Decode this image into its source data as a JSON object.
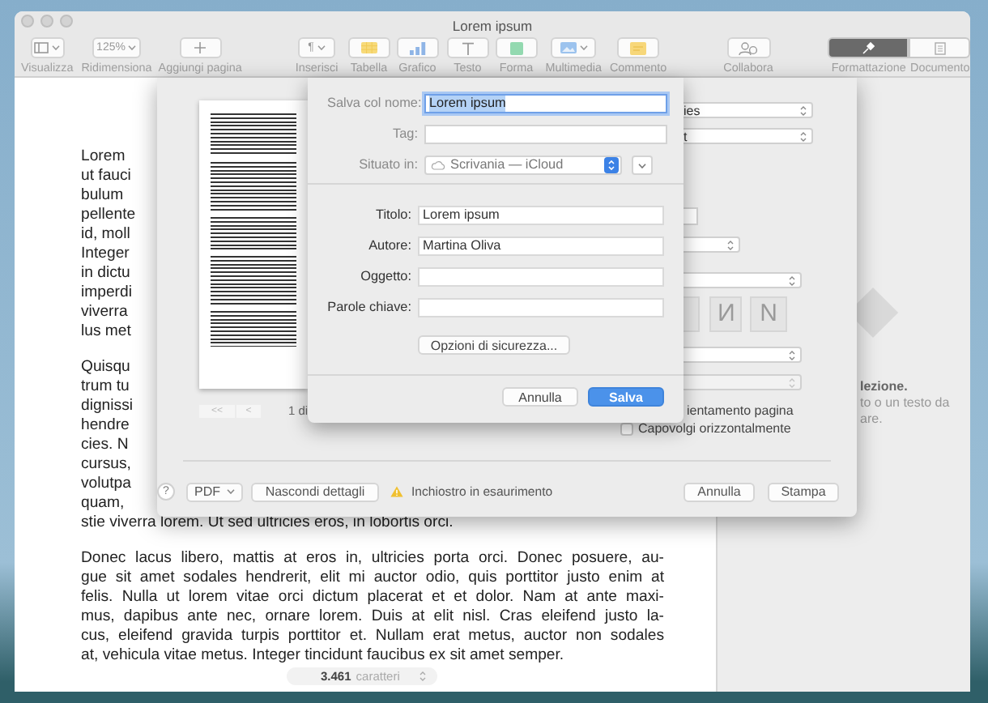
{
  "window": {
    "title": "Lorem ipsum"
  },
  "toolbar": [
    {
      "kind": "view",
      "label": "Visualizza"
    },
    {
      "kind": "zoom",
      "label": "Ridimensiona",
      "value": "125%"
    },
    {
      "kind": "add",
      "label": "Aggiungi pagina"
    },
    {
      "kind": "insert",
      "label": "Inserisci",
      "value": "¶"
    },
    {
      "kind": "table",
      "label": "Tabella"
    },
    {
      "kind": "chart",
      "label": "Grafico"
    },
    {
      "kind": "text",
      "label": "Testo"
    },
    {
      "kind": "shape",
      "label": "Forma"
    },
    {
      "kind": "media",
      "label": "Multimedia"
    },
    {
      "kind": "comment",
      "label": "Commento"
    },
    {
      "kind": "collab",
      "label": "Collabora"
    }
  ],
  "inspector_tabs": [
    {
      "kind": "format",
      "label": "Formattazione",
      "selected": true
    },
    {
      "kind": "document",
      "label": "Documento",
      "selected": false
    }
  ],
  "document": {
    "paragraphs": [
      {
        "cut_off": true,
        "lines": [
          "Lorem",
          "ut fauci",
          "bulum",
          "pellente",
          "id, moll",
          "Integer",
          "in dictu",
          "imperdi",
          "viverra",
          "lus met"
        ]
      },
      {
        "cut_off": true,
        "lines": [
          "Quisqu",
          "trum tu",
          "dignissi",
          "hendre",
          "cies. N",
          "cursus,",
          "volutpa",
          "quam,",
          "stie viverra lorem. Ut sed ultricies eros, in lobortis orci."
        ]
      },
      {
        "cut_off": false,
        "lines": [
          "Donec lacus libero, mattis at eros in, ultricies porta orci. Donec posuere, au-",
          "gue sit amet sodales hendrerit, elit mi auctor odio, quis porttitor justo enim at",
          "felis. Nulla ut lorem vitae orci dictum placerat et et dolor. Nam at ante maxi-",
          "mus, dapibus ante nec, ornare lorem. Duis at elit nisl. Cras eleifend justo la-",
          "cus, eleifend gravida turpis porttitor et. Nullam erat metus, auctor non sodales",
          "at, vehicula vitae metus. Integer tincidunt faucibus ex sit amet semper."
        ]
      }
    ]
  },
  "word_count": {
    "count": "3.461",
    "label": "caratteri"
  },
  "inspector": {
    "lines": [
      "lezione.",
      "to o un testo da",
      "are."
    ]
  },
  "print_sheet": {
    "page_nav": [
      "<<",
      "<"
    ],
    "page_indicator": "1 di",
    "settings": [
      {
        "kind": "popup",
        "value": "ies",
        "disabled": false
      },
      {
        "kind": "popup",
        "value": "t",
        "disabled": false
      },
      {
        "kind": "field"
      },
      {
        "kind": "popup",
        "disabled": false
      },
      {
        "kind": "popup",
        "disabled": false
      },
      {
        "kind": "style_buttons",
        "buttons": [
          {
            "kind": "blank"
          },
          {
            "kind": "glyph",
            "glyph": "N",
            "mirrored": true
          },
          {
            "kind": "glyph",
            "glyph": "N",
            "mirrored": false
          }
        ]
      },
      {
        "kind": "popup",
        "disabled": false
      },
      {
        "kind": "popup",
        "disabled": true
      },
      {
        "kind": "label",
        "label": "ientamento pagina"
      },
      {
        "kind": "checkbox",
        "label": "Capovolgi orizzontalmente",
        "checked": false
      }
    ],
    "help": "?",
    "pdf": "PDF",
    "details_button": "Nascondi dettagli",
    "warning": "Inchiostro in esaurimento",
    "buttons": [
      "Annulla",
      "Stampa"
    ]
  },
  "save_sheet": {
    "fields": [
      {
        "kind": "text",
        "label": "Salva col nome:",
        "value": "Lorem ipsum",
        "focused": true
      },
      {
        "kind": "text",
        "label": "Tag:",
        "focused": false
      },
      {
        "kind": "location",
        "label": "Situato in:",
        "value": "Scrivania — iCloud"
      }
    ],
    "metadata": [
      {
        "label": "Titolo:",
        "value": "Lorem ipsum"
      },
      {
        "label": "Autore:",
        "value": "Martina Oliva"
      },
      {
        "label": "Oggetto:"
      },
      {
        "label": "Parole chiave:"
      }
    ],
    "options_button": "Opzioni di sicurezza...",
    "buttons": [
      {
        "label": "Annulla",
        "default": false
      },
      {
        "label": "Salva",
        "default": true
      }
    ]
  }
}
